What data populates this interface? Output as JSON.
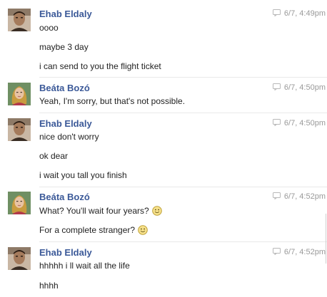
{
  "messages": [
    {
      "sender": "Ehab Eldaly",
      "time": "6/7, 4:49pm",
      "lines": [
        "oooo",
        "maybe 3 day",
        "i can send to you the flight ticket"
      ]
    },
    {
      "sender": "Beáta Bozó",
      "time": "6/7, 4:50pm",
      "lines": [
        "Yeah, I'm sorry, but that's not possible."
      ]
    },
    {
      "sender": "Ehab Eldaly",
      "time": "6/7, 4:50pm",
      "lines": [
        "nice don't worry",
        "ok dear",
        "i wait you tall you finish"
      ]
    },
    {
      "sender": "Beáta Bozó",
      "time": "6/7, 4:52pm",
      "lines": [
        "What? You'll wait four years?",
        "For a complete stranger?"
      ]
    },
    {
      "sender": "Ehab Eldaly",
      "time": "6/7, 4:52pm",
      "lines": [
        "hhhhh i ll wait all the life",
        "hhhh"
      ]
    }
  ],
  "colors": {
    "sender_name": "#3b5998",
    "timestamp": "#999999",
    "message_text": "#222222"
  },
  "icons": {
    "reply": "reply-icon",
    "smiley": "smiley-emoticon-icon"
  }
}
